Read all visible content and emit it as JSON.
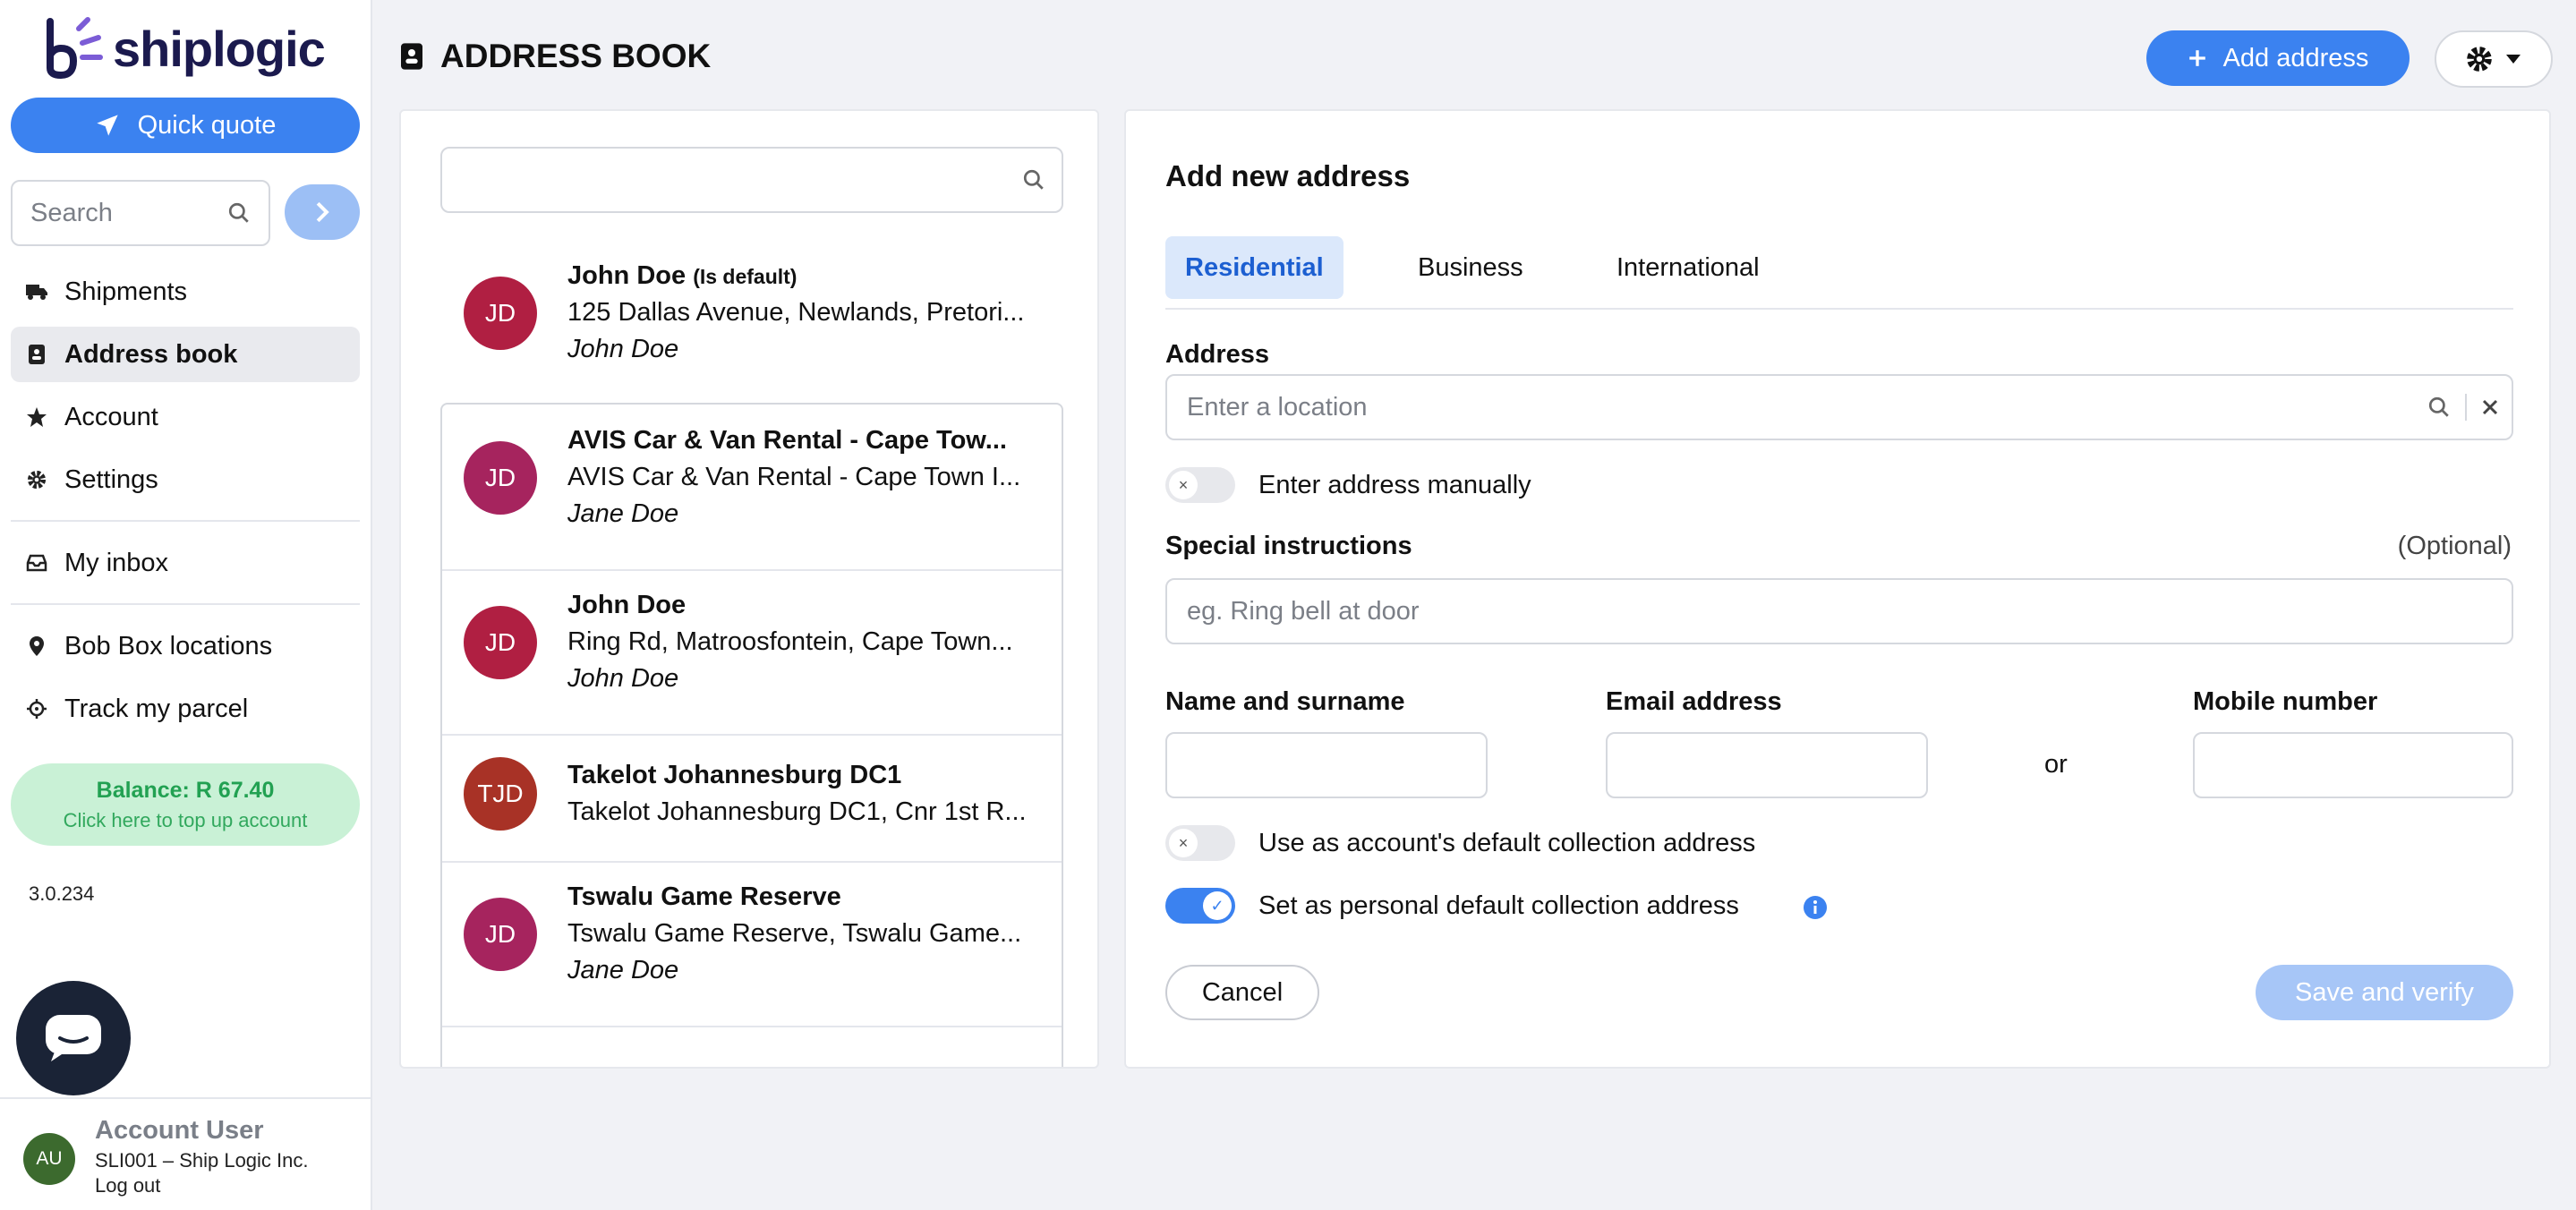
{
  "sidebar": {
    "brand": "shiplogic",
    "quick_quote": "Quick quote",
    "search_placeholder": "Search",
    "nav": [
      {
        "label": "Shipments",
        "icon": "truck-icon"
      },
      {
        "label": "Address book",
        "icon": "address-book-icon",
        "active": true
      },
      {
        "label": "Account",
        "icon": "star-icon"
      },
      {
        "label": "Settings",
        "icon": "gear-icon"
      },
      {
        "label": "My inbox",
        "icon": "inbox-icon"
      },
      {
        "label": "Bob Box locations",
        "icon": "map-pin-icon"
      },
      {
        "label": "Track my parcel",
        "icon": "crosshair-icon"
      }
    ],
    "balance": "Balance: R 67.40",
    "balance_hint": "Click here to top up account",
    "version": "3.0.234",
    "user": {
      "initials": "AU",
      "name": "Account User",
      "org": "SLI001 – Ship Logic Inc.",
      "logout": "Log out"
    }
  },
  "header": {
    "title": "ADDRESS BOOK",
    "add_address": "Add address"
  },
  "address_list": [
    {
      "initials": "JD",
      "color": "#b01f42",
      "name": "John Doe",
      "default_tag": "(Is default)",
      "address": "125 Dallas Avenue, Newlands, Pretori...",
      "contact": "John Doe"
    },
    {
      "initials": "JD",
      "color": "#a6245e",
      "name": "AVIS Car & Van Rental - Cape Tow...",
      "address": "AVIS Car & Van Rental - Cape Town I...",
      "contact": "Jane Doe"
    },
    {
      "initials": "JD",
      "color": "#b01f42",
      "name": "John Doe",
      "address": "Ring Rd, Matroosfontein, Cape Town...",
      "contact": "John Doe"
    },
    {
      "initials": "TJD",
      "color": "#a83226",
      "name": "Takelot Johannesburg DC1",
      "address": "Takelot Johannesburg DC1, Cnr 1st R...",
      "contact": ""
    },
    {
      "initials": "JD",
      "color": "#a6245e",
      "name": "Tswalu Game Reserve",
      "address": "Tswalu Game Reserve, Tswalu Game...",
      "contact": "Jane Doe"
    }
  ],
  "form": {
    "title": "Add new address",
    "tabs": [
      "Residential",
      "Business",
      "International"
    ],
    "address_label": "Address",
    "address_placeholder": "Enter a location",
    "manual_toggle": "Enter address manually",
    "special_label": "Special instructions",
    "optional": "(Optional)",
    "special_placeholder": "eg. Ring bell at door",
    "name_label": "Name and surname",
    "email_label": "Email address",
    "or": "or",
    "mobile_label": "Mobile number",
    "account_default": "Use as account's default collection address",
    "personal_default": "Set as personal default collection address",
    "cancel": "Cancel",
    "save": "Save and verify"
  },
  "colors": {
    "accent": "#3b82f0",
    "brand_dark": "#1b1a4e",
    "brand_purple": "#7b5cd6"
  }
}
